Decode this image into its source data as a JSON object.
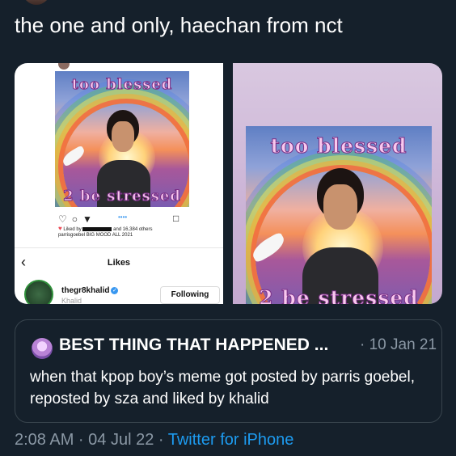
{
  "tweet": {
    "text": "the one and only, haechan from nct"
  },
  "media": {
    "left_panel": {
      "meme_caption_top": "too blessed",
      "meme_caption_bottom": "2 be stressed",
      "liked_by": "Liked by",
      "liked_by_tail": "and 16,384 others",
      "post_caption": "parrisgoebel BIG MOOD ALL 2021",
      "likes_title": "Likes",
      "back_icon": "chevron-left-icon",
      "user_handle": "thegr8khalid",
      "user_name": "Khalid",
      "follow_button": "Following"
    },
    "right_panel": {
      "meme_caption_top": "too blessed",
      "meme_caption_bottom": "2 be stressed"
    }
  },
  "quote": {
    "name": "BEST THING THAT HAPPENED ...",
    "date": "· 10 Jan 21",
    "text": "when that kpop boy’s meme got posted by parris goebel, reposted by sza and liked by khalid"
  },
  "meta": {
    "time": "2:08 AM · 04 Jul 22 · ",
    "source": "Twitter for iPhone"
  },
  "colors": {
    "background": "#15202b",
    "border": "#38444d",
    "muted": "#8b98a5",
    "accent": "#1d9bf0"
  }
}
